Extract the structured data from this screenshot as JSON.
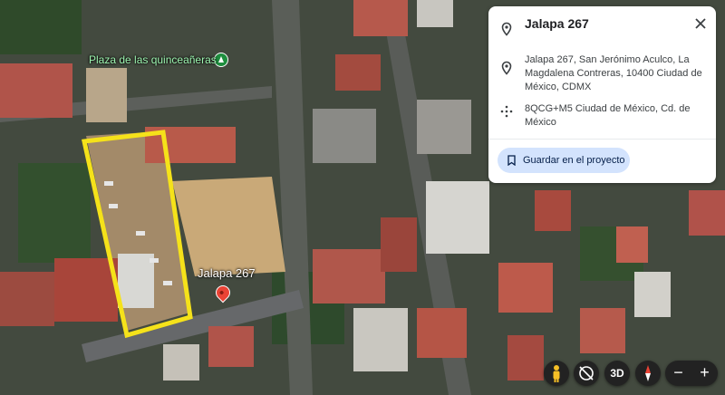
{
  "map": {
    "poi_label": "Plaza de las quinceañeras",
    "pin_label": "Jalapa 267",
    "highlight_color": "#f5e21a"
  },
  "place_card": {
    "title": "Jalapa 267",
    "address": "Jalapa 267, San Jerónimo Aculco, La Magdalena Contreras, 10400 Ciudad de México, CDMX",
    "plus_code": "8QCG+M5 Ciudad de México, Cd. de México",
    "save_label": "Guardar en el proyecto",
    "accent_color": "#d3e3fd"
  },
  "controls": {
    "pegman": "pegman-icon",
    "tilt": "tilt-icon",
    "three_d_label": "3D",
    "compass": "compass-icon",
    "zoom_out": "−",
    "zoom_in": "+"
  }
}
